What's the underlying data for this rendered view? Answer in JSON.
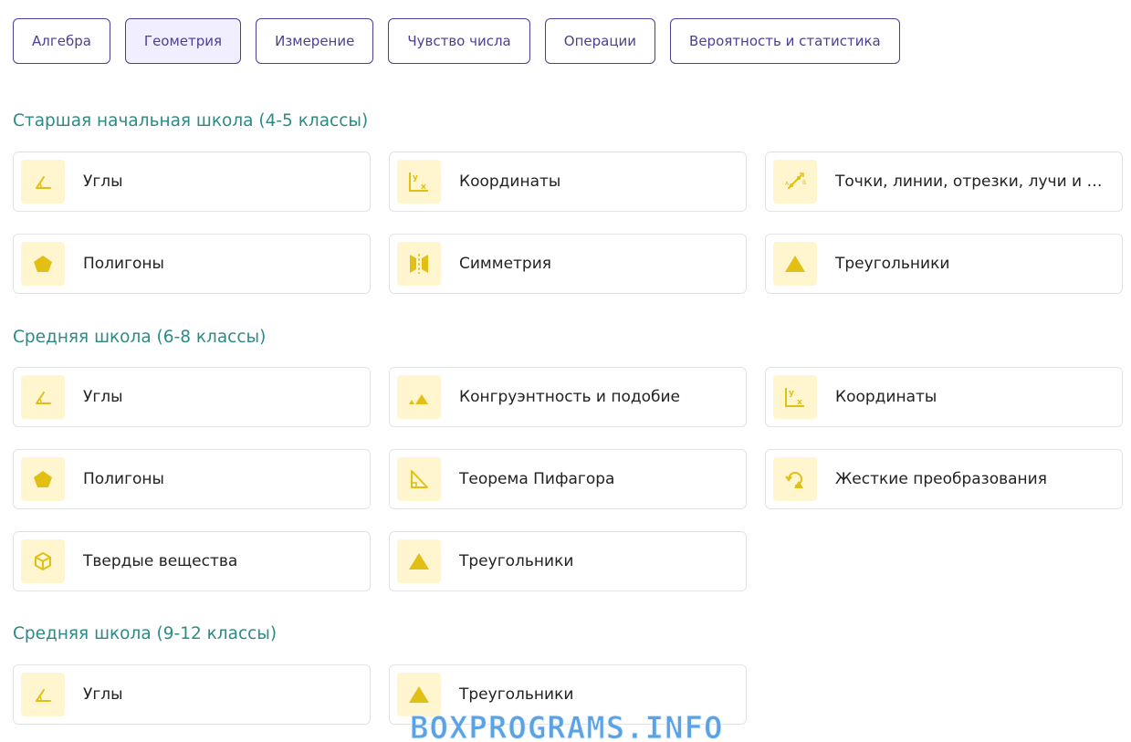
{
  "tabs": [
    {
      "label": "Алгебра",
      "active": false
    },
    {
      "label": "Геометрия",
      "active": true
    },
    {
      "label": "Измерение",
      "active": false
    },
    {
      "label": "Чувство числа",
      "active": false
    },
    {
      "label": "Операции",
      "active": false
    },
    {
      "label": "Вероятность и статистика",
      "active": false
    }
  ],
  "sections": [
    {
      "title": "Старшая начальная школа (4-5 классы)",
      "items": [
        {
          "label": "Углы",
          "icon": "angle-icon"
        },
        {
          "label": "Координаты",
          "icon": "coordinates-icon"
        },
        {
          "label": "Точки, линии, отрезки, лучи и плоскости",
          "icon": "line-segment-icon"
        },
        {
          "label": "Полигоны",
          "icon": "pentagon-icon"
        },
        {
          "label": "Симметрия",
          "icon": "symmetry-icon"
        },
        {
          "label": "Треугольники",
          "icon": "triangle-icon"
        }
      ]
    },
    {
      "title": "Средняя школа (6-8 классы)",
      "items": [
        {
          "label": "Углы",
          "icon": "angle-icon"
        },
        {
          "label": "Конгруэнтность и подобие",
          "icon": "similar-triangles-icon"
        },
        {
          "label": "Координаты",
          "icon": "coordinates-icon"
        },
        {
          "label": "Полигоны",
          "icon": "pentagon-icon"
        },
        {
          "label": "Теорема Пифагора",
          "icon": "right-triangle-icon"
        },
        {
          "label": "Жесткие преобразования",
          "icon": "rotation-icon"
        },
        {
          "label": "Твердые вещества",
          "icon": "cube-icon"
        },
        {
          "label": "Треугольники",
          "icon": "triangle-icon"
        }
      ]
    },
    {
      "title": "Средняя школа (9-12 классы)",
      "items": [
        {
          "label": "Углы",
          "icon": "angle-icon"
        },
        {
          "label": "Треугольники",
          "icon": "triangle-icon"
        }
      ]
    }
  ],
  "watermark": "BOXPROGRAMS.INFO",
  "colors": {
    "accent": "#4b3f95",
    "section_title": "#2e8a84",
    "icon_bg": "#fff6cf",
    "icon_fg": "#e2bf14"
  }
}
